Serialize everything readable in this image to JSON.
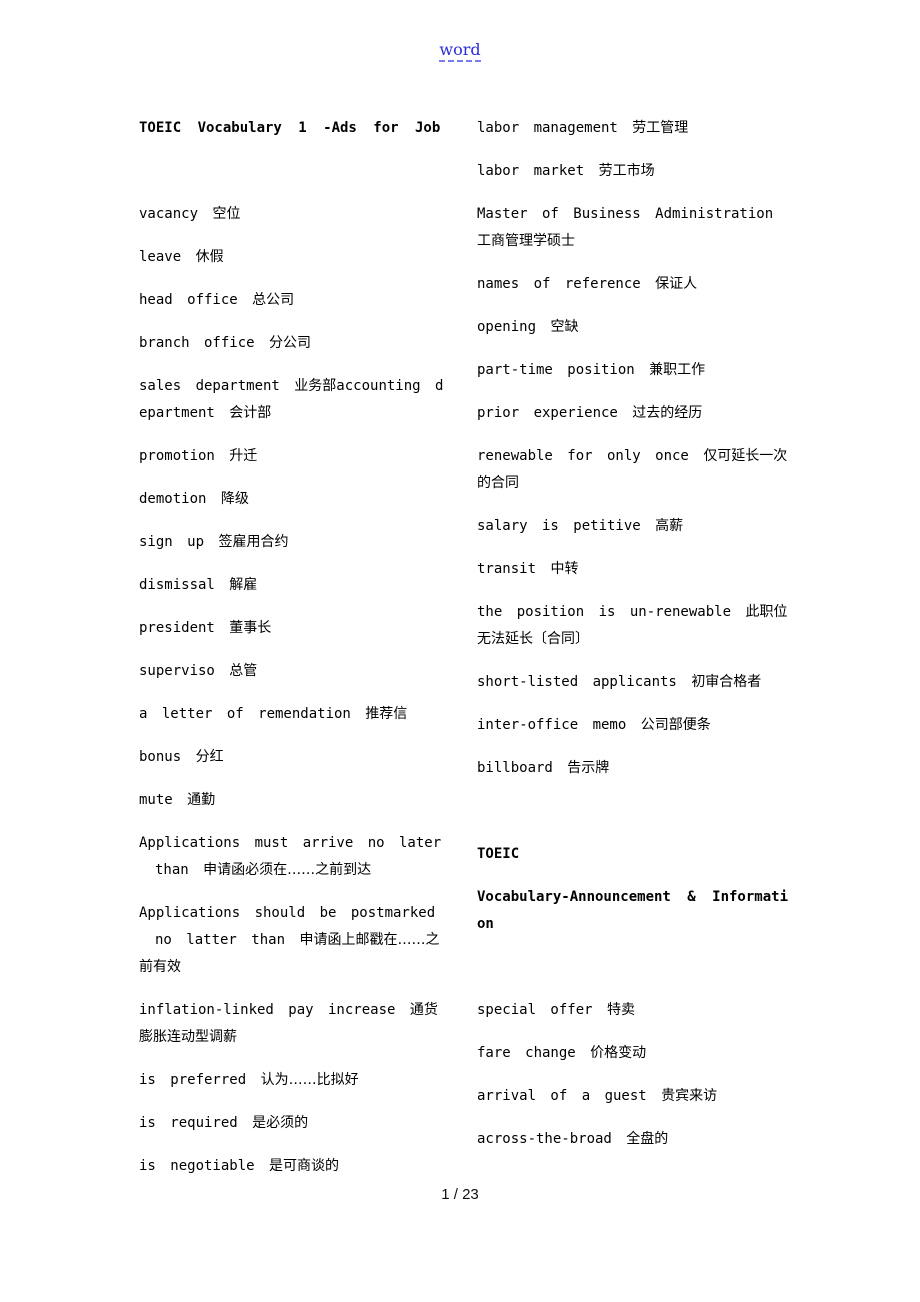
{
  "header": {
    "link_text": "word"
  },
  "left_column": {
    "title": "TOEIC Vocabulary 1 -Ads for Job",
    "entries": [
      {
        "en": "vacancy",
        "cn": "空位"
      },
      {
        "en": "leave",
        "cn": "休假"
      },
      {
        "en": "head office",
        "cn": "总公司"
      },
      {
        "en": "branch office",
        "cn": "分公司"
      },
      {
        "en": "sales department",
        "cn": "业务部",
        "en2": "accounting department",
        "cn2": "会计部"
      },
      {
        "en": "promotion",
        "cn": "升迁"
      },
      {
        "en": "demotion",
        "cn": "降级"
      },
      {
        "en": "sign up",
        "cn": "签雇用合约"
      },
      {
        "en": "dismissal",
        "cn": "解雇"
      },
      {
        "en": "president",
        "cn": "董事长"
      },
      {
        "en": "superviso",
        "cn": "总管"
      },
      {
        "en": "a letter of remendation",
        "cn": "推荐信"
      },
      {
        "en": "bonus",
        "cn": "分红"
      },
      {
        "en": "mute",
        "cn": "通勤"
      },
      {
        "en": "Applications must arrive no later",
        "en_cont": "than",
        "cn": "申请函必须在……之前到达"
      },
      {
        "en": "Applications should be postmarked",
        "en_cont": "no latter than",
        "cn": "申请函上邮戳在……之前有效"
      },
      {
        "en": "inflation-linked pay increase",
        "cn": "通货膨胀连动型调薪"
      },
      {
        "en": "is preferred",
        "cn": "认为……比拟好"
      },
      {
        "en": "is required",
        "cn": "是必须的"
      },
      {
        "en": "is negotiable",
        "cn": "是可商谈的"
      }
    ]
  },
  "right_column": {
    "entries_top": [
      {
        "en": "labor management",
        "cn": "劳工管理"
      },
      {
        "en": "labor market",
        "cn": "劳工市场"
      },
      {
        "en": "Master of Business Administration",
        "cn": "工商管理学硕士"
      },
      {
        "en": "names of reference",
        "cn": "保证人"
      },
      {
        "en": "opening",
        "cn": "空缺"
      },
      {
        "en": "part-time position",
        "cn": "兼职工作"
      },
      {
        "en": "prior experience",
        "cn": "过去的经历"
      },
      {
        "en": "renewable for only once",
        "cn": "仅可延长一次的合同"
      },
      {
        "en": "salary is petitive",
        "cn": "高薪"
      },
      {
        "en": "transit",
        "cn": "中转"
      },
      {
        "en": "the position is un-renewable",
        "cn": "此职位无法延长〔合同〕"
      },
      {
        "en": "short-listed applicants",
        "cn": "初审合格者"
      },
      {
        "en": "inter-office memo",
        "cn": "公司部便条"
      },
      {
        "en": "billboard",
        "cn": "告示牌"
      }
    ],
    "section2_title_line1": "TOEIC",
    "section2_title_line2": "Vocabulary-Announcement & Information",
    "entries_bottom": [
      {
        "en": "special offer",
        "cn": "特卖"
      },
      {
        "en": "fare change",
        "cn": "价格变动"
      },
      {
        "en": "arrival of a guest",
        "cn": "贵宾来访"
      },
      {
        "en": "across-the-broad",
        "cn": "全盘的"
      }
    ]
  },
  "footer": {
    "page_indicator": "1 / 23"
  }
}
